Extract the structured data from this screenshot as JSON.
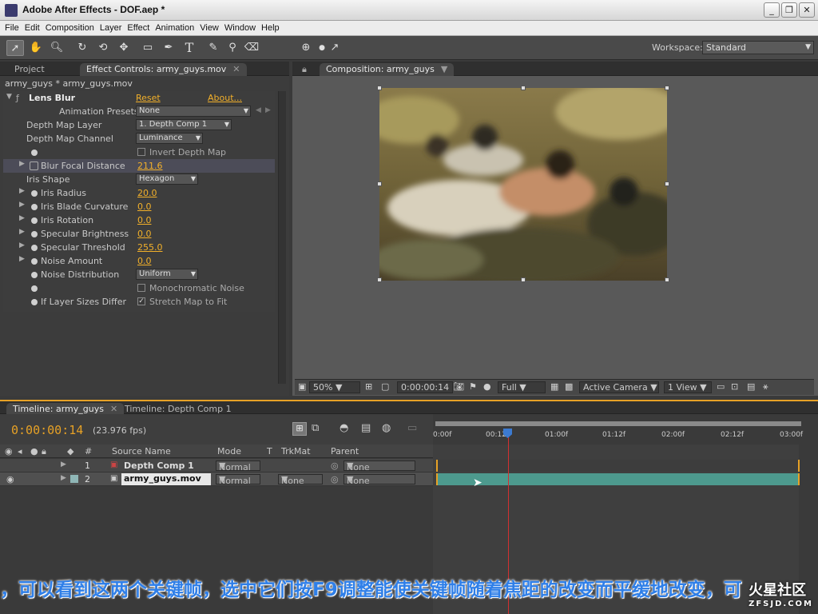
{
  "window": {
    "title": "Adobe After Effects - DOF.aep *",
    "controls": [
      "_",
      "❐",
      "✕"
    ]
  },
  "menu": [
    "File",
    "Edit",
    "Composition",
    "Layer",
    "Effect",
    "Animation",
    "View",
    "Window",
    "Help"
  ],
  "toolbar": {
    "workspace_label": "Workspace:",
    "workspace_value": "Standard"
  },
  "left_panel": {
    "tabs": [
      {
        "label": "Project"
      },
      {
        "label": "Effect Controls: army_guys.mov"
      }
    ],
    "breadcrumb": "army_guys * army_guys.mov",
    "effect": {
      "name": "Lens Blur",
      "reset": "Reset",
      "about": "About..."
    },
    "presets_label": "Animation Presets:",
    "presets_value": "None",
    "rows": [
      {
        "label": "Depth Map Layer",
        "type": "dropdown",
        "value": "1. Depth Comp 1"
      },
      {
        "label": "Depth Map Channel",
        "type": "dropdown",
        "value": "Luminance"
      },
      {
        "label": "",
        "type": "checkbox",
        "value": "Invert Depth Map",
        "checked": false
      },
      {
        "label": "Blur Focal Distance",
        "type": "number",
        "value": "211.6"
      },
      {
        "label": "Iris Shape",
        "type": "dropdown",
        "value": "Hexagon"
      },
      {
        "label": "Iris Radius",
        "type": "number",
        "value": "20.0"
      },
      {
        "label": "Iris Blade Curvature",
        "type": "number",
        "value": "0.0"
      },
      {
        "label": "Iris Rotation",
        "type": "number",
        "value": "0.0"
      },
      {
        "label": "Specular Brightness",
        "type": "number",
        "value": "0.0"
      },
      {
        "label": "Specular Threshold",
        "type": "number",
        "value": "255.0"
      },
      {
        "label": "Noise Amount",
        "type": "number",
        "value": "0.0"
      },
      {
        "label": "Noise Distribution",
        "type": "dropdown",
        "value": "Uniform"
      },
      {
        "label": "",
        "type": "checkbox",
        "value": "Monochromatic Noise",
        "checked": false
      },
      {
        "label": "If Layer Sizes Differ",
        "type": "checkbox",
        "value": "Stretch Map to Fit",
        "checked": true
      }
    ]
  },
  "comp_panel": {
    "tab": "Composition: army_guys",
    "footer": {
      "zoom": "50%",
      "timecode": "0:00:00:14",
      "resolution": "Full",
      "camera": "Active Camera",
      "view": "1 View"
    }
  },
  "timeline": {
    "tabs": [
      {
        "label": "Timeline: army_guys"
      },
      {
        "label": "Timeline: Depth Comp 1"
      }
    ],
    "current_time": "0:00:00:14",
    "fps": "(23.976 fps)",
    "columns": {
      "num": "#",
      "source": "Source Name",
      "mode": "Mode",
      "t": "T",
      "trkmat": "TrkMat",
      "parent": "Parent"
    },
    "layers": [
      {
        "num": "1",
        "name": "Depth Comp 1",
        "mode": "Normal",
        "trkmat": "",
        "parent": "None"
      },
      {
        "num": "2",
        "name": "army_guys.mov",
        "mode": "Normal",
        "trkmat": "None",
        "parent": "None"
      }
    ],
    "ruler_ticks": [
      "0:00f",
      "00:12f",
      "01:00f",
      "01:12f",
      "02:00f",
      "02:12f",
      "03:00f"
    ],
    "current_fraction": 0.19
  },
  "overlay": {
    "subtitle": "，可以看到这两个关键帧，选中它们按F9调整能使关键帧随着焦距的改变而平缓地改变，可",
    "watermark": "火星社区",
    "watermark_url": "ZFSJD.COM"
  }
}
